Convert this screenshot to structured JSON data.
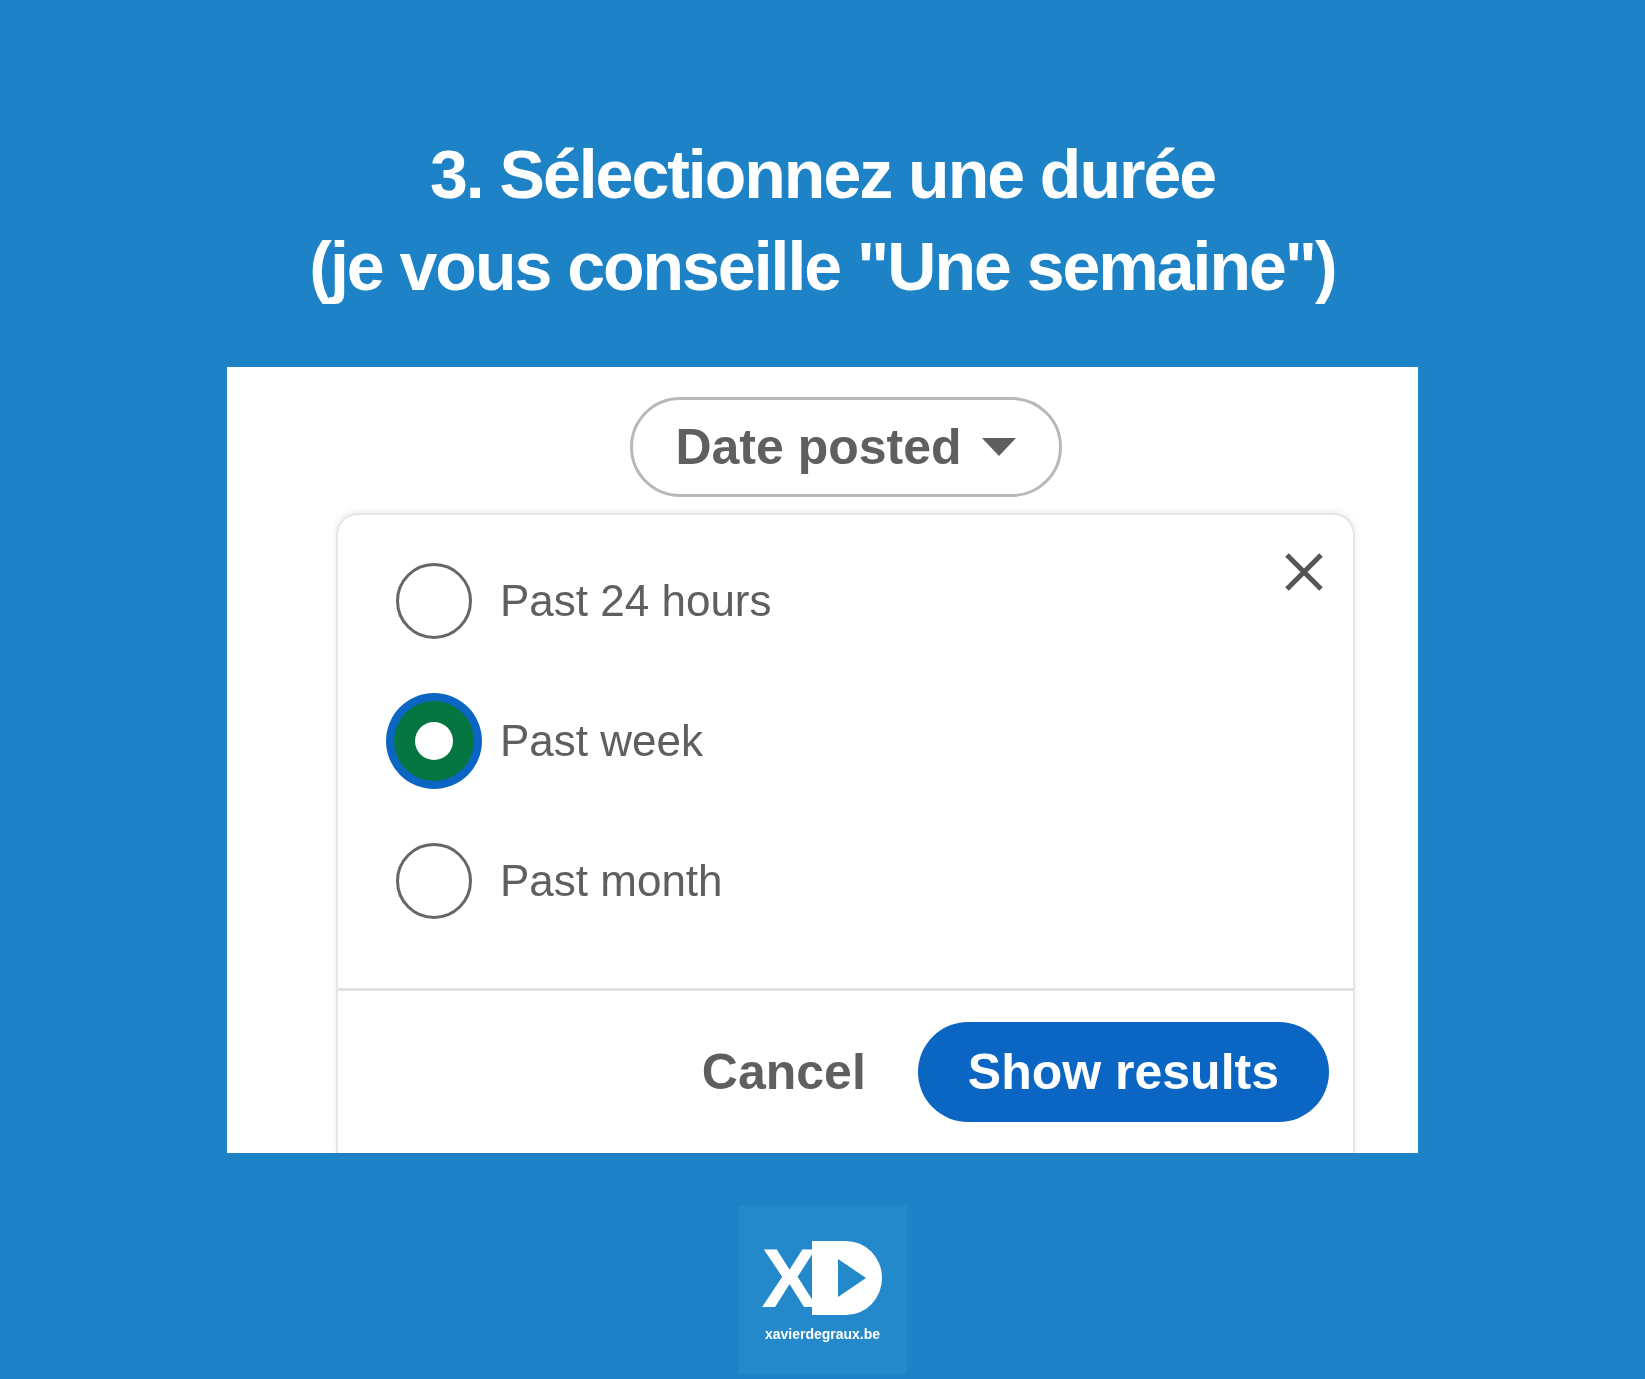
{
  "heading": [
    "3. Sélectionnez une durée",
    "(je vous conseille \"Une semaine\")"
  ],
  "filter": {
    "label": "Date posted"
  },
  "options": [
    {
      "label": "Past 24 hours",
      "selected": false
    },
    {
      "label": "Past week",
      "selected": true
    },
    {
      "label": "Past month",
      "selected": false
    }
  ],
  "actions": {
    "cancel": "Cancel",
    "submit": "Show results"
  },
  "logo": {
    "letter": "X",
    "site": "xavierdegraux.be"
  }
}
